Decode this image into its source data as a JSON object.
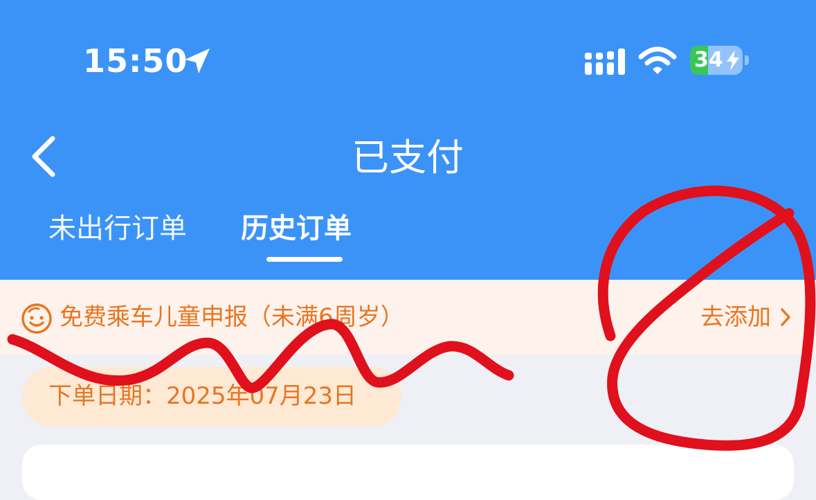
{
  "status_bar": {
    "time": "15:50",
    "battery_level": "34",
    "battery_fraction": 0.34,
    "icons": [
      "location-arrow-icon",
      "cellular-signal-icon",
      "wifi-icon",
      "battery-charging-icon"
    ]
  },
  "nav": {
    "title": "已支付",
    "back_icon": "chevron-left-icon"
  },
  "tabs": [
    {
      "label": "未出行订单",
      "active": false
    },
    {
      "label": "历史订单",
      "active": true
    }
  ],
  "child_banner": {
    "text": "免费乘车儿童申报（未满6周岁）",
    "action_label": "去添加",
    "icon": "smiley-face-icon"
  },
  "order": {
    "date_label": "下单日期：2025年07月23日"
  },
  "colors": {
    "header_blue": "#3b93f7",
    "accent_orange": "#e97522",
    "banner_bg": "#fdf3ec",
    "date_pill_bg": "#fde9d4",
    "page_bg": "#eef0f5",
    "markup_red": "#e0101c",
    "battery_green": "#39c659"
  }
}
